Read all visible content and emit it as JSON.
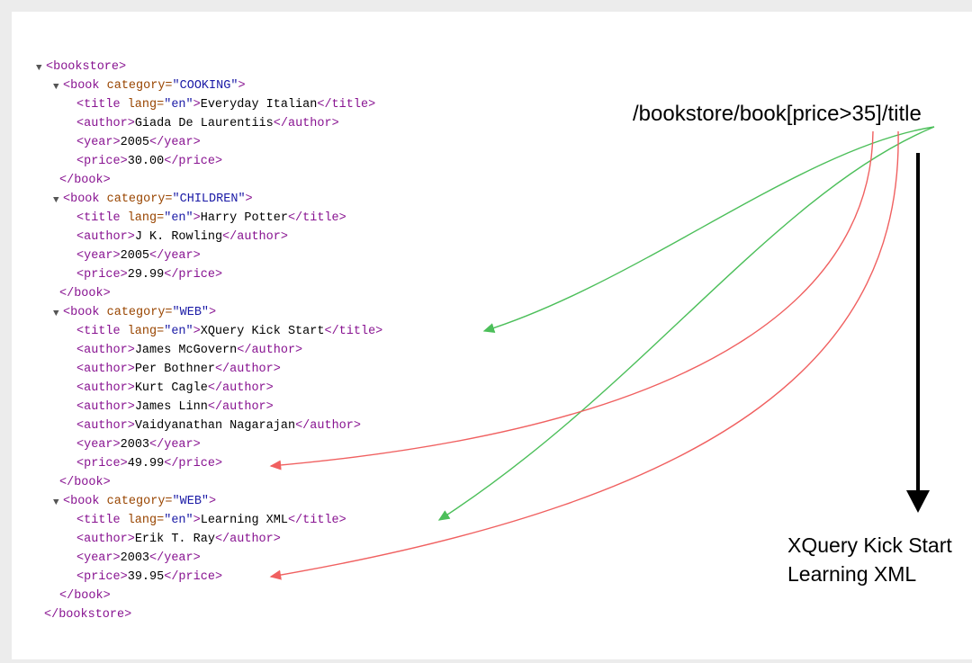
{
  "xpath": "/bookstore/book[price>35]/title",
  "results": [
    "XQuery Kick Start",
    "Learning XML"
  ],
  "colors": {
    "match_arrow": "#4cbf5a",
    "filter_arrow": "#f06060",
    "result_arrow": "#000000"
  },
  "xml": {
    "root_open": "bookstore",
    "root_close": "bookstore",
    "books": [
      {
        "category": "COOKING",
        "title_lang": "en",
        "title": "Everyday Italian",
        "authors": [
          "Giada De Laurentiis"
        ],
        "year": "2005",
        "price": "30.00"
      },
      {
        "category": "CHILDREN",
        "title_lang": "en",
        "title": "Harry Potter",
        "authors": [
          "J K. Rowling"
        ],
        "year": "2005",
        "price": "29.99"
      },
      {
        "category": "WEB",
        "title_lang": "en",
        "title": "XQuery Kick Start",
        "authors": [
          "James McGovern",
          "Per Bothner",
          "Kurt Cagle",
          "James Linn",
          "Vaidyanathan Nagarajan"
        ],
        "year": "2003",
        "price": "49.99"
      },
      {
        "category": "WEB",
        "title_lang": "en",
        "title": "Learning XML",
        "authors": [
          "Erik T. Ray"
        ],
        "year": "2003",
        "price": "39.95"
      }
    ]
  }
}
